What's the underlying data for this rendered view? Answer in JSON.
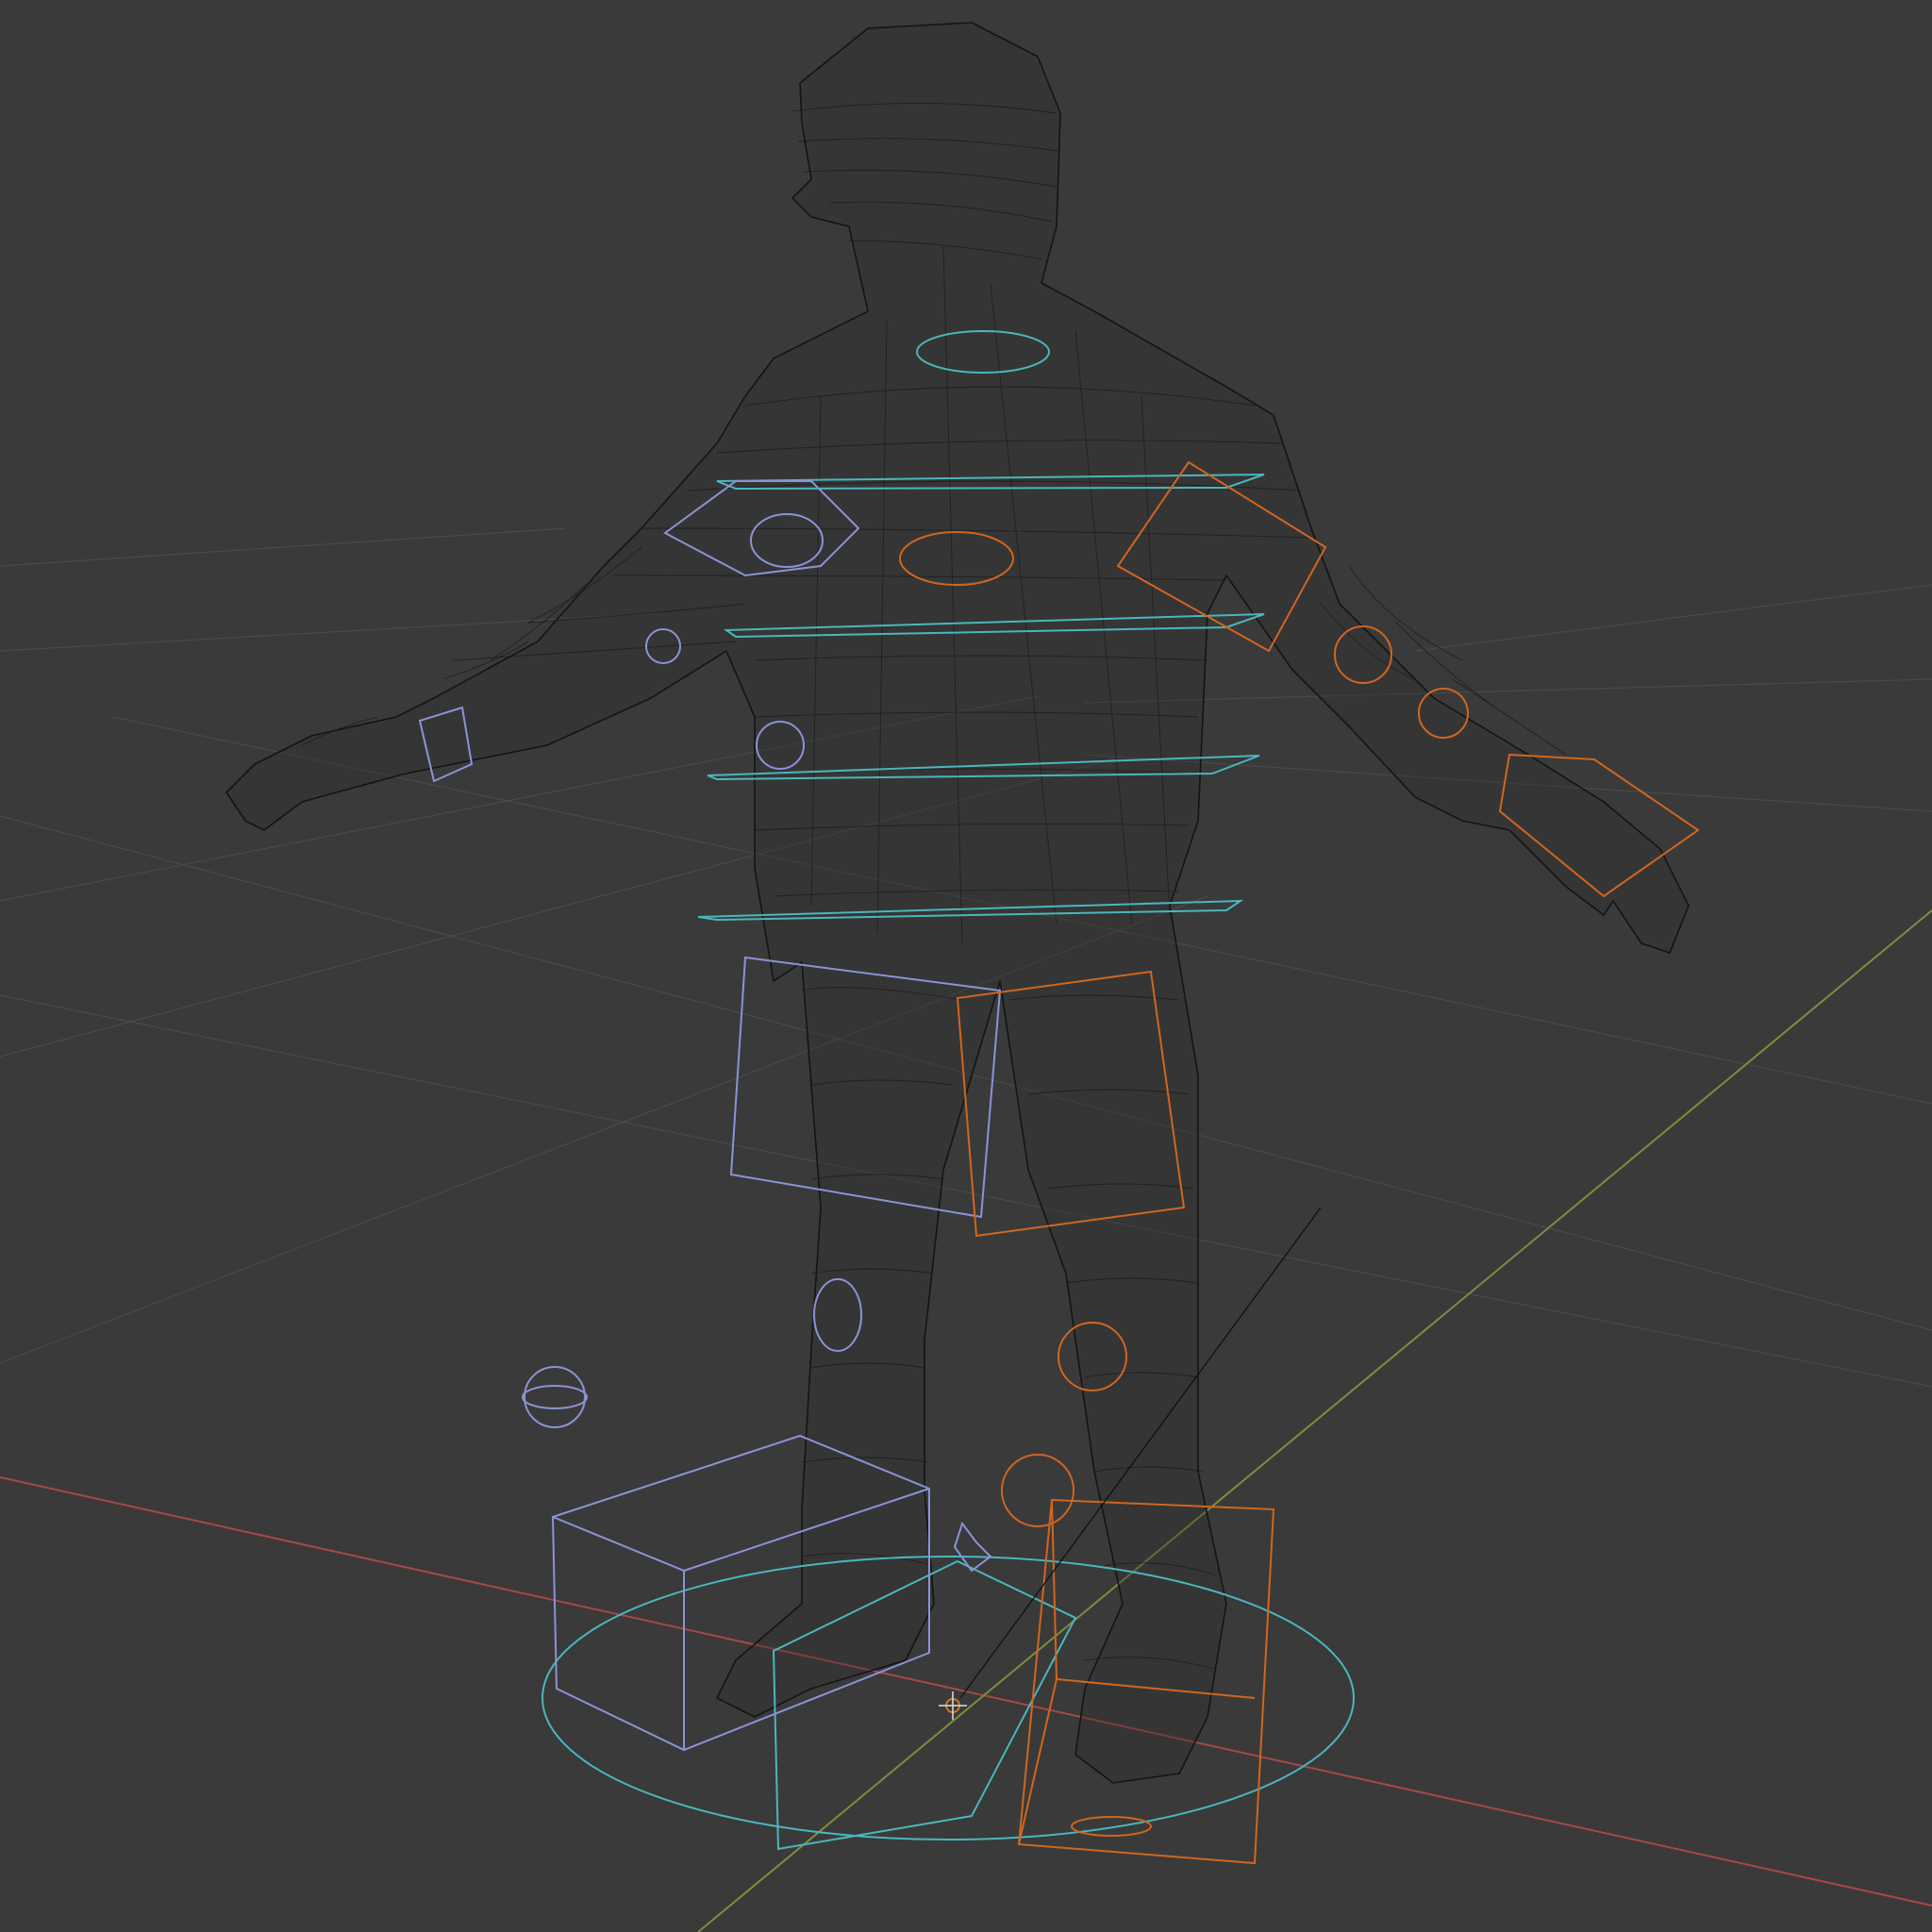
{
  "viewport": {
    "shading": "wireframe",
    "background_color": "#3a3a3a"
  },
  "colors": {
    "grid": "#4a4a4a",
    "x_axis": "#a84848",
    "y_axis": "#7e8e3c",
    "mesh_wire": "#141414",
    "control_center": "#49b7bd",
    "control_left": "#8b93d6",
    "control_right": "#d0661f",
    "cursor_3d": "#c97a2a"
  },
  "objects": {
    "character_mesh": "character-wireframe-mesh",
    "armature": "character-rig-controls",
    "cursor": "3d-cursor"
  }
}
